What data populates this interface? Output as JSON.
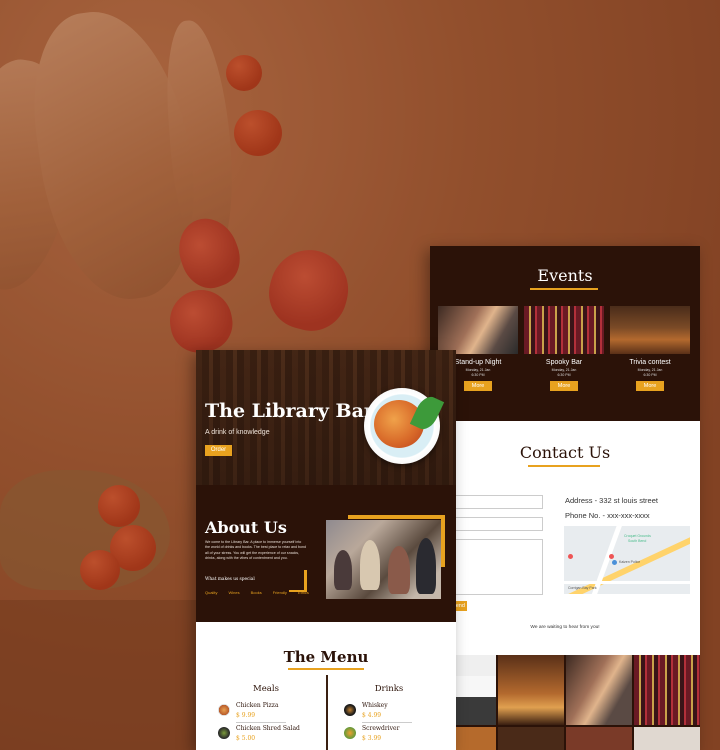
{
  "library_bar": {
    "hero": {
      "title": "The Library Bar",
      "subtitle": "A drink of knowledge",
      "order_button": "Order"
    },
    "about": {
      "title": "About Us",
      "text": "We come to the Library Bar. A place to immerse yourself into the world of drinks and books. The best place to relax and bond all of your stress. You will get the experience of our snacks, drinks, along with the vibes of contentment and you.",
      "special_label": "What makes us special",
      "links": [
        "Quality",
        "Wines",
        "Books",
        "Friendly",
        "Ethics"
      ]
    },
    "menu": {
      "title": "The Menu",
      "meals_heading": "Meals",
      "drinks_heading": "Drinks",
      "meals": [
        {
          "name": "Chicken Pizza",
          "price": "$ 9.99"
        },
        {
          "name": "Chicken Shred Salad",
          "price": "$ 5.00"
        }
      ],
      "drinks": [
        {
          "name": "Whiskey",
          "price": "$ 4.99"
        },
        {
          "name": "Screwdriver",
          "price": "$ 3.99"
        }
      ]
    }
  },
  "events_page": {
    "title": "Events",
    "events": [
      {
        "name": "Stand-up Night",
        "date": "Monday, 21 Jan",
        "time": "6:30 PM",
        "button": "More"
      },
      {
        "name": "Spooky Bar",
        "date": "Monday, 21 Jan",
        "time": "6:30 PM",
        "button": "More"
      },
      {
        "name": "Trivia contest",
        "date": "Monday, 21 Jan",
        "time": "6:30 PM",
        "button": "More"
      }
    ],
    "contact": {
      "title": "Contact Us",
      "address": "Address - 332 st louis street",
      "phone": "Phone No. - xxx-xxx-xxxx",
      "send_button": "Send",
      "footer": "We are waiting to hear from you!",
      "map_labels": [
        "Croquet Grounds",
        "South Bend",
        "Kaizen Police",
        "Corrigan Bay Park"
      ]
    }
  },
  "colors": {
    "dark_brown": "#2b1208",
    "accent_orange": "#e8a21f",
    "background_overlay": "#8a4a2a"
  }
}
